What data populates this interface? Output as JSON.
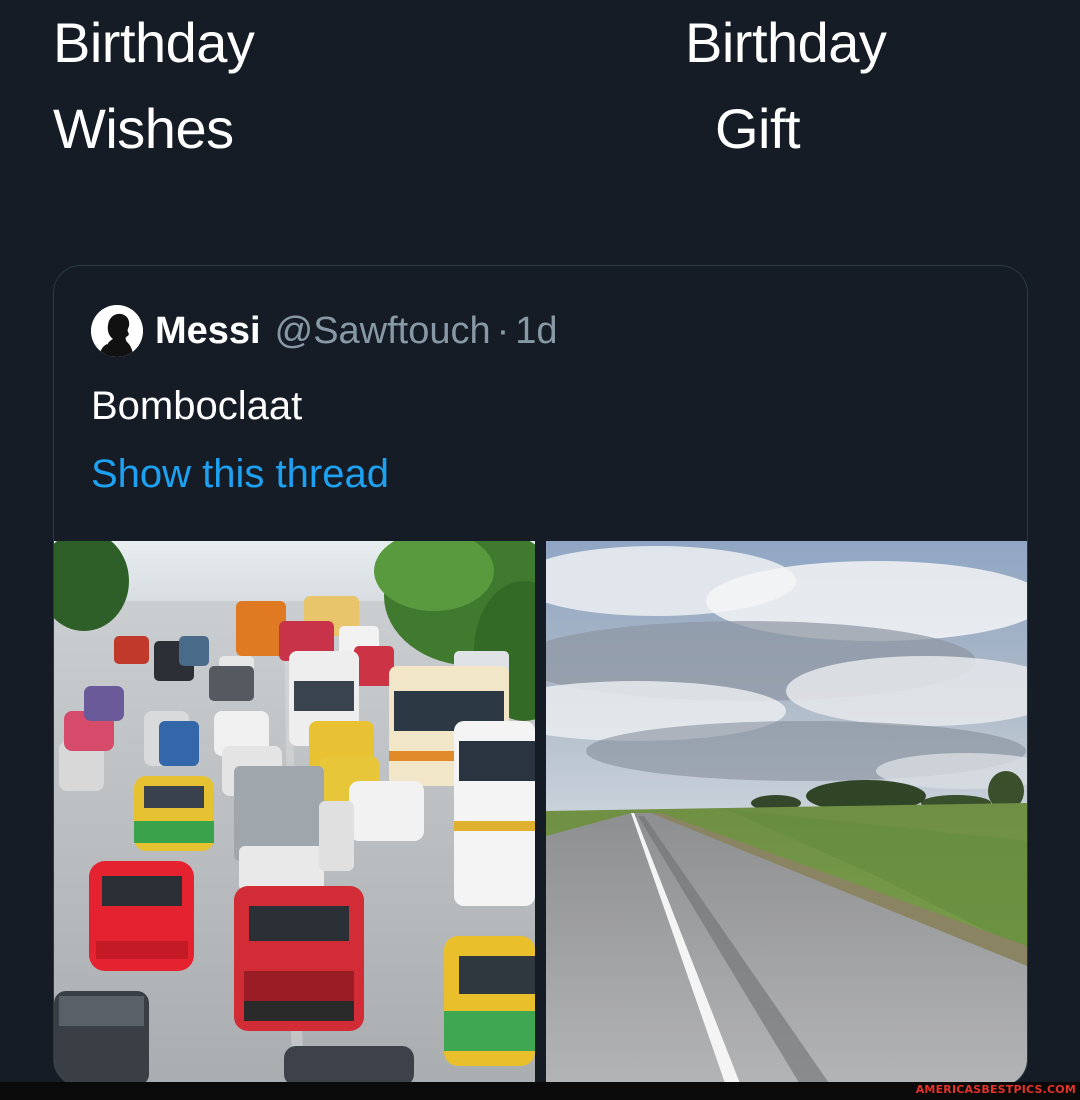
{
  "captions": {
    "left": {
      "line1": "Birthday",
      "line2": "Wishes"
    },
    "right": {
      "line1": "Birthday",
      "line2": "Gift"
    }
  },
  "tweet": {
    "display_name": "Messi",
    "handle": "@Sawftouch",
    "separator": "·",
    "time": "1d",
    "text": "Bomboclaat",
    "thread_link": "Show this thread",
    "avatar_icon": "silhouette-avatar-icon",
    "link_color": "#1da1f2"
  },
  "media": {
    "left_photo": "traffic-jam-photo",
    "right_photo": "empty-road-photo"
  },
  "watermark": "AMERICASBESTPICS.COM",
  "colors": {
    "background": "#151c25",
    "secondary_text": "#8899a6",
    "watermark": "#e5332a"
  }
}
